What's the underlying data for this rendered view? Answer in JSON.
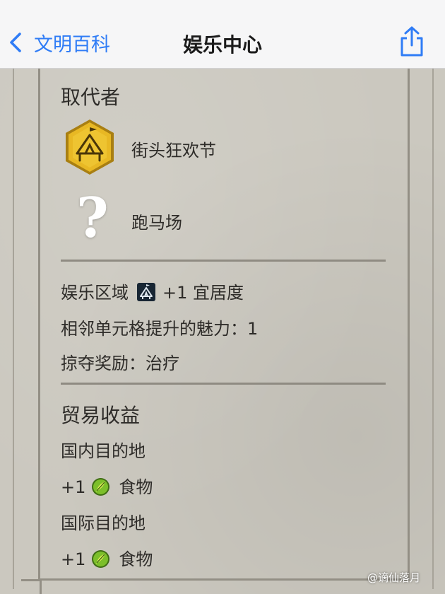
{
  "navbar": {
    "back_label": "文明百科",
    "title": "娱乐中心"
  },
  "replaced_by": {
    "heading": "取代者",
    "items": [
      {
        "name": "街头狂欢节",
        "icon": "street-carnival-hex-icon"
      },
      {
        "name": "跑马场",
        "icon": "unknown-question-icon"
      }
    ]
  },
  "stats": {
    "amenity": {
      "label": "娱乐区域",
      "icon": "entertainment-district-icon",
      "value": "+1 宜居度"
    },
    "appeal": "相邻单元格提升的魅力：1",
    "plunder": "掠夺奖励：治疗"
  },
  "trade": {
    "heading": "贸易收益",
    "domestic": {
      "label": "国内目的地",
      "amount": "+1",
      "yield_icon": "food-icon",
      "yield": "食物"
    },
    "international": {
      "label": "国际目的地",
      "amount": "+1",
      "yield_icon": "food-icon",
      "yield": "食物"
    }
  },
  "watermark": "@谪仙落月",
  "colors": {
    "accent": "#2f7cf6",
    "gold": "#e8b824",
    "parchment": "#cbc8bf",
    "text": "#2e2c29"
  }
}
